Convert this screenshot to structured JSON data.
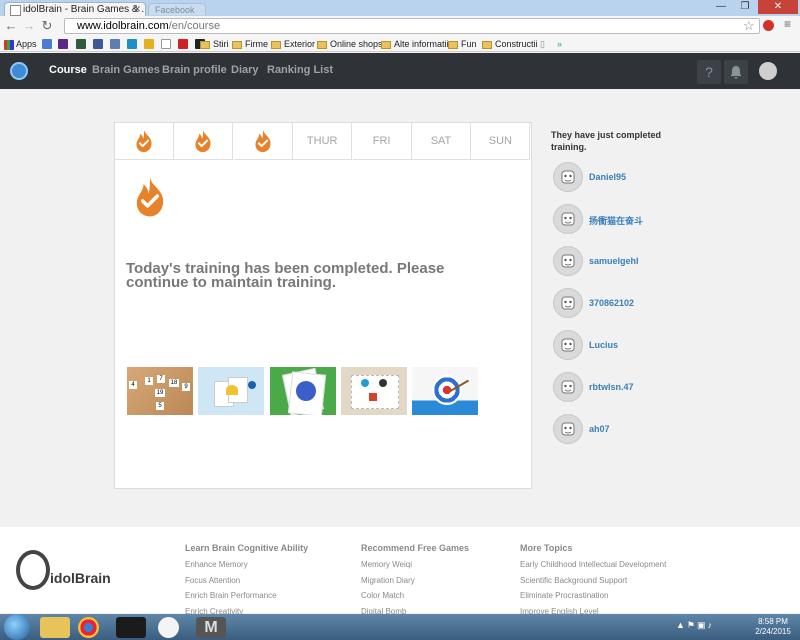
{
  "browser": {
    "tab_title": "idolBrain - Brain Games & ...",
    "tab2_title": "Facebook",
    "url_host": "www.idolbrain.com",
    "url_path": "/en/course",
    "bookmarks": [
      "Apps",
      "Stiri",
      "Firme",
      "Exterior",
      "Online shops",
      "Alte informatii",
      "Fun",
      "Constructii"
    ]
  },
  "nav": {
    "items": [
      "Course",
      "Brain Games",
      "Brain profile",
      "Diary",
      "Ranking List"
    ],
    "help_icon": "?"
  },
  "week": {
    "days": [
      "",
      "",
      "",
      "THUR",
      "FRI",
      "SAT",
      "SUN"
    ],
    "completed": [
      true,
      true,
      true,
      false,
      false,
      false,
      false
    ]
  },
  "card": {
    "message": "Today's training has been completed. Please continue to maintain training.",
    "thumbnail_numbers": [
      "4",
      "1",
      "7",
      "18",
      "9",
      "19",
      "5"
    ]
  },
  "sidebar": {
    "title": "They have just completed training.",
    "users": [
      "Daniel95",
      "扬衝猫在奋斗",
      "samuelgehl",
      "370862102",
      "Lucius",
      "rbtwlsn.47",
      "ah07"
    ]
  },
  "footer": {
    "logo": "idolBrain",
    "columns": [
      {
        "title": "Learn Brain Cognitive Ability",
        "links": [
          "Enhance Memory",
          "Focus Attention",
          "Enrich Brain Performance",
          "Enrich Creativity"
        ]
      },
      {
        "title": "Recommend Free Games",
        "links": [
          "Memory Weiqi",
          "Migration Diary",
          "Color Match",
          "Digital Bomb"
        ]
      },
      {
        "title": "More Topics",
        "links": [
          "Early Childhood Intellectual Development",
          "Scientific Background Support",
          "Eliminate Procrastination",
          "Improve English Level"
        ]
      }
    ]
  },
  "taskbar": {
    "time": "8:58 PM",
    "date": "2/24/2015"
  },
  "colors": {
    "flame": "#e8822a",
    "nav_bg": "#2f3338",
    "link_blue": "#3a7fb8"
  }
}
